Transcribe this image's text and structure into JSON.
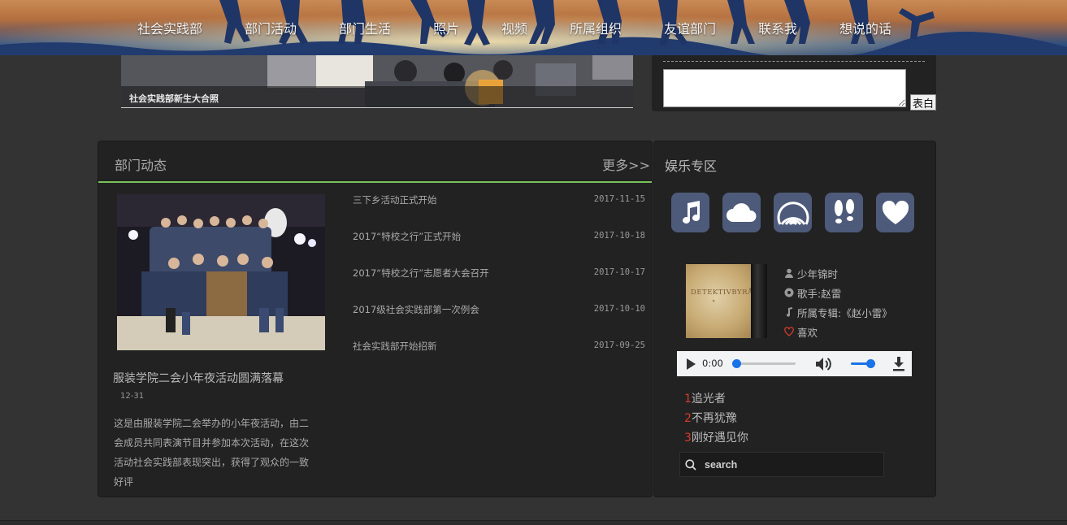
{
  "nav": {
    "items": [
      "社会实践部",
      "部门活动",
      "部门生活",
      "照片",
      "视频",
      "所属组织",
      "友谊部门",
      "联系我",
      "想说的话"
    ]
  },
  "banner": {
    "caption": "社会实践部新生大合照"
  },
  "message": {
    "submit_label": "表白",
    "textarea_value": ""
  },
  "news": {
    "title": "部门动态",
    "more_label": "更多>>",
    "feature": {
      "title": "服装学院二会小年夜活动圆满落幕",
      "date": "12-31",
      "description": "这是由服装学院二会举办的小年夜活动，由二会成员共同表演节目并参加本次活动，在这次活动社会实践部表现突出，获得了观众的一致好评"
    },
    "items": [
      {
        "title": "三下乡活动正式开始",
        "date": "2017-11-15"
      },
      {
        "title": "2017“特校之行”正式开始",
        "date": "2017-10-18"
      },
      {
        "title": "2017“特校之行”志愿者大会召开",
        "date": "2017-10-17"
      },
      {
        "title": "2017级社会实践部第一次例会",
        "date": "2017-10-10"
      },
      {
        "title": "社会实践部开始招新",
        "date": "2017-09-25"
      }
    ]
  },
  "entertainment": {
    "title": "娱乐专区",
    "icons": [
      "music-icon",
      "cloud-icon",
      "podcast-icon",
      "footprints-icon",
      "heart-icon"
    ],
    "tile_color": "#4e5a7a",
    "album_cover_text": "DETEKTIVBYRÅN",
    "song": {
      "title": "少年锦时",
      "artist": "歌手:赵雷",
      "album": "所属专辑:《赵小雷》",
      "like_label": "喜欢"
    },
    "player": {
      "time": "0:00",
      "progress": 0,
      "volume": 0.9
    },
    "playlist": [
      {
        "num": "1",
        "title": "追光者"
      },
      {
        "num": "2",
        "title": "不再犹豫"
      },
      {
        "num": "3",
        "title": "刚好遇见你"
      }
    ],
    "search": {
      "placeholder": "search",
      "value": ""
    }
  },
  "colors": {
    "accent_green": "#79c25a",
    "playlist_number": "#d83a2c",
    "player_blue": "#1a73e8",
    "like_heart": "#d83a2c"
  }
}
